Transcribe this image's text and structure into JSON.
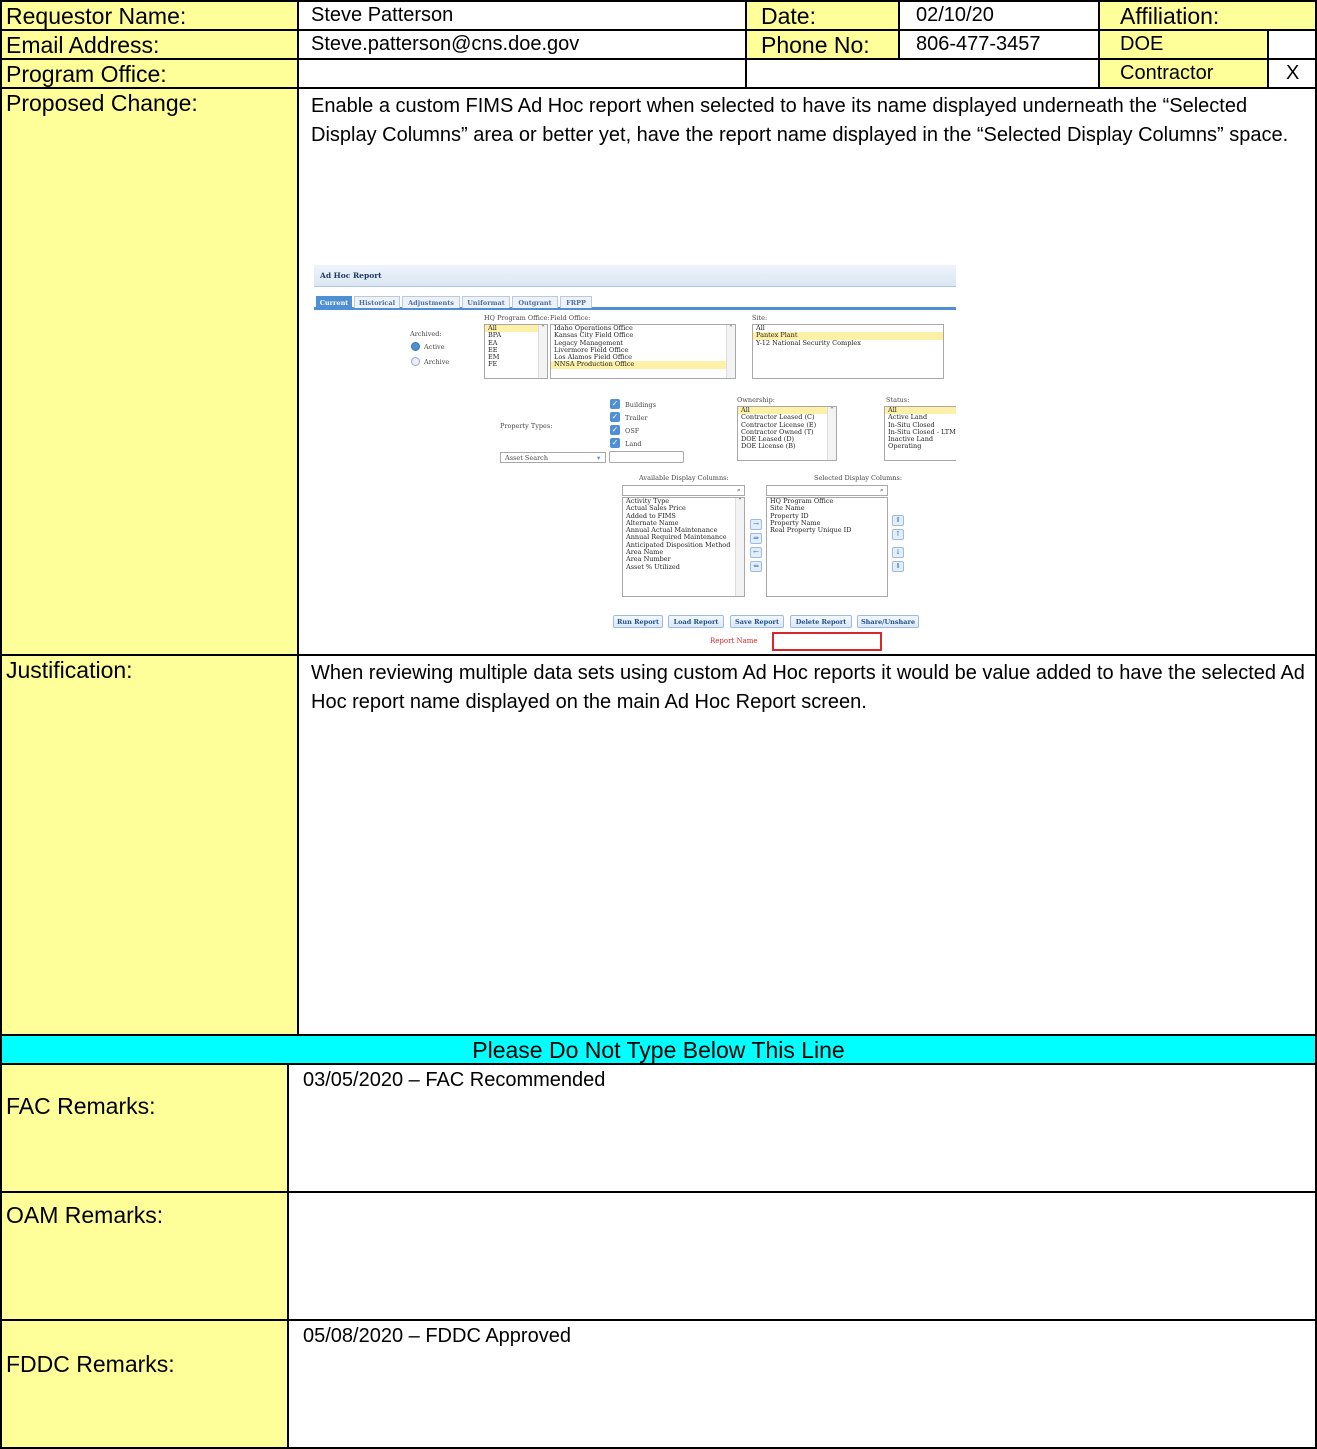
{
  "header": {
    "requestor_label": "Requestor Name:",
    "requestor_value": "Steve Patterson",
    "date_label": "Date:",
    "date_value": "02/10/20",
    "affiliation_label": "Affiliation:",
    "email_label": "Email Address:",
    "email_value": "Steve.patterson@cns.doe.gov",
    "phone_label": "Phone No:",
    "phone_value": "806-477-3457",
    "affiliation_doe": "DOE",
    "program_office_label": "Program Office:",
    "affiliation_contractor": "Contractor",
    "contractor_mark": "X"
  },
  "proposed_change": {
    "label": "Proposed Change:",
    "text": "Enable a custom FIMS Ad Hoc report when selected to have its name displayed underneath the “Selected Display Columns” area or better yet, have the report name displayed in the “Selected Display Columns” space."
  },
  "screenshot": {
    "title": "Ad Hoc Report",
    "tabs": [
      "Current",
      "Historical",
      "Adjustments",
      "Uniformat",
      "Outgrant",
      "FRPP"
    ],
    "hq_program_office_label": "HQ Program Office:",
    "hq_items": [
      "All",
      "BPA",
      "EA",
      "EE",
      "EM",
      "FE"
    ],
    "field_office_label": "Field Office:",
    "field_items": [
      "Idaho Operations Office",
      "Kansas City Field Office",
      "Legacy Management",
      "Livermore Field Office",
      "Los Alamos Field Office",
      "NNSA Production Office"
    ],
    "site_label": "Site:",
    "site_items": [
      "All",
      "Pantex Plant",
      "Y-12 National Security Complex"
    ],
    "archived_label": "Archived:",
    "active_label": "Active",
    "archive_label": "Archive",
    "property_types_label": "Property Types:",
    "property_types": [
      "Buildings",
      "Trailer",
      "OSF",
      "Land"
    ],
    "ownership_label": "Ownership:",
    "ownership_items": [
      "All",
      "Contractor Leased (C)",
      "Contractor License (E)",
      "Contractor Owned (T)",
      "DOE Leased (D)",
      "DOE License (B)"
    ],
    "status_label": "Status:",
    "status_items": [
      "All",
      "Active Land",
      "In-Situ Closed",
      "In-Situ Closed - LTM",
      "Inactive Land",
      "Operating"
    ],
    "asset_search": "Asset Search",
    "available_label": "Available Display Columns:",
    "available_items": [
      "Activity Type",
      "Actual Sales Price",
      "Added to FIMS",
      "Alternate Name",
      "Annual Actual Maintenance",
      "Annual Required Maintenance",
      "Anticipated Disposition Method",
      "Area Name",
      "Area Number",
      "Asset % Utilized"
    ],
    "selected_label": "Selected Display Columns:",
    "selected_items": [
      "HQ Program Office",
      "Site Name",
      "Property ID",
      "Property Name",
      "Real Property Unique ID"
    ],
    "buttons": [
      "Run Report",
      "Load Report",
      "Save Report",
      "Delete Report",
      "Share/Unshare"
    ],
    "report_name_label": "Report Name"
  },
  "justification": {
    "label": "Justification:",
    "text": "When reviewing multiple data sets using custom Ad Hoc reports it would be value added to have the selected Ad Hoc report name displayed on the main Ad Hoc Report screen."
  },
  "divider": {
    "text": "Please Do Not Type Below This Line"
  },
  "remarks": [
    {
      "label": "FAC Remarks:",
      "value": "03/05/2020 – FAC Recommended"
    },
    {
      "label": "OAM Remarks:",
      "value": ""
    },
    {
      "label": "FDDC Remarks:",
      "value": "05/08/2020 – FDDC Approved"
    }
  ],
  "colors": {
    "label_bg": "#ffff99",
    "divider_bg": "#00ffff",
    "accent": "#4f8fd3",
    "report_name": "#d9262b"
  }
}
